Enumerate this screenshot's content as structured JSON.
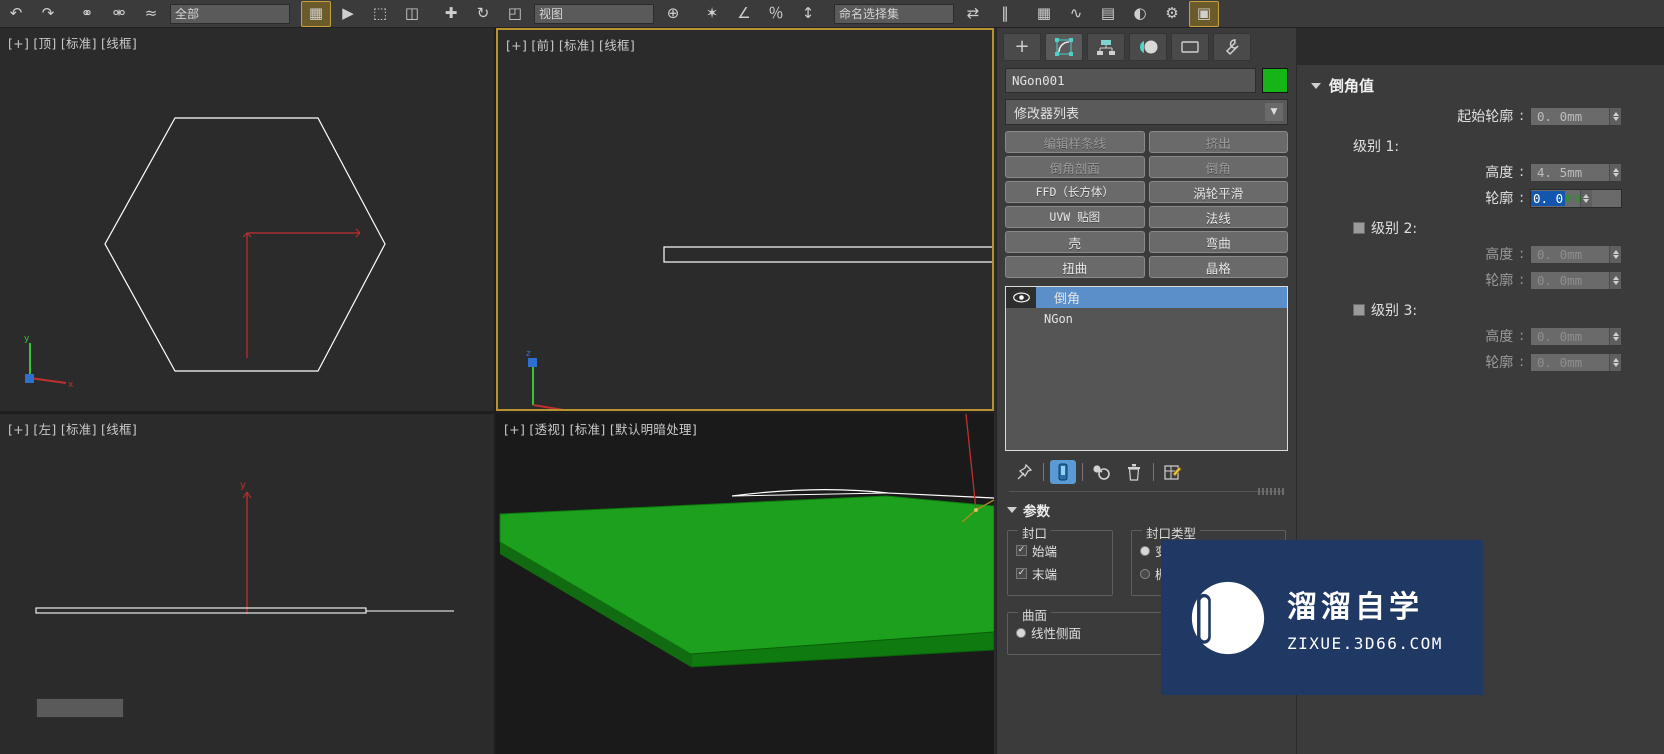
{
  "toolbar": {
    "items": [
      {
        "name": "undo-icon",
        "glyph": "↶"
      },
      {
        "name": "redo-icon",
        "glyph": "↷"
      },
      {
        "name": "select-link-icon",
        "glyph": "⚭"
      },
      {
        "name": "unlink-icon",
        "glyph": "⚮"
      },
      {
        "name": "bind-space-warp-icon",
        "glyph": "≈"
      },
      {
        "name": "selection-filter-dropdown",
        "glyph": "全部"
      },
      {
        "name": "select-object-icon",
        "glyph": "⬚"
      },
      {
        "name": "select-by-name-icon",
        "glyph": "↖"
      },
      {
        "name": "select-region-icon",
        "glyph": "⬚"
      },
      {
        "name": "window-crossing-icon",
        "glyph": "◫"
      },
      {
        "name": "select-and-move-icon",
        "glyph": "✚"
      },
      {
        "name": "select-and-rotate-icon",
        "glyph": "↻"
      },
      {
        "name": "select-and-scale-icon",
        "glyph": "◰"
      },
      {
        "name": "reference-coord-system",
        "glyph": "视图"
      },
      {
        "name": "use-pivot-icon",
        "glyph": "⊕"
      },
      {
        "name": "snap-toggle-icon",
        "glyph": "✦"
      },
      {
        "name": "angle-snap-icon",
        "glyph": "∠"
      },
      {
        "name": "percent-snap-icon",
        "glyph": "％"
      },
      {
        "name": "spinner-snap-icon",
        "glyph": "↕"
      },
      {
        "name": "named-selection-field",
        "glyph": "命名选择集"
      },
      {
        "name": "mirror-icon",
        "glyph": "⇄"
      },
      {
        "name": "align-icon",
        "glyph": "‖"
      },
      {
        "name": "layer-manager-icon",
        "glyph": "▦"
      },
      {
        "name": "curve-editor-icon",
        "glyph": "∿"
      },
      {
        "name": "schematic-view-icon",
        "glyph": "▤"
      },
      {
        "name": "material-editor-icon",
        "glyph": "◐"
      },
      {
        "name": "render-setup-icon",
        "glyph": "⚙"
      },
      {
        "name": "render-frame-icon",
        "glyph": "▣"
      },
      {
        "name": "render-production-icon",
        "glyph": "☕"
      }
    ]
  },
  "viewports": {
    "top": {
      "label": "[+] [顶] [标准] [线框]"
    },
    "front": {
      "label": "[+] [前] [标准] [线框]"
    },
    "left": {
      "label": "[+] [左] [标准] [线框]"
    },
    "persp": {
      "label": "[+] [透视] [标准] [默认明暗处理]"
    }
  },
  "command_panel": {
    "tabs": [
      {
        "name": "create-tab",
        "icon": "＋"
      },
      {
        "name": "modify-tab",
        "icon": "⬡"
      },
      {
        "name": "hierarchy-tab",
        "icon": "┳"
      },
      {
        "name": "motion-tab",
        "icon": "◑"
      },
      {
        "name": "display-tab",
        "icon": "▭"
      },
      {
        "name": "utilities-tab",
        "icon": "🔧"
      }
    ],
    "object_name": "NGon001",
    "object_color": "#17b417",
    "modifier_list_label": "修改器列表",
    "modifier_buttons": [
      {
        "label": "编辑样条线",
        "dim": true,
        "mono": false
      },
      {
        "label": "挤出",
        "dim": true,
        "mono": false
      },
      {
        "label": "倒角剖面",
        "dim": true,
        "mono": false
      },
      {
        "label": "倒角",
        "dim": true,
        "mono": false
      },
      {
        "label": "FFD（长方体）",
        "dim": false,
        "mono": true
      },
      {
        "label": "涡轮平滑",
        "dim": false,
        "mono": false
      },
      {
        "label": "UVW 贴图",
        "dim": false,
        "mono": true
      },
      {
        "label": "法线",
        "dim": false,
        "mono": false
      },
      {
        "label": "壳",
        "dim": false,
        "mono": false
      },
      {
        "label": "弯曲",
        "dim": false,
        "mono": false
      },
      {
        "label": "扭曲",
        "dim": false,
        "mono": false
      },
      {
        "label": "晶格",
        "dim": false,
        "mono": false
      }
    ],
    "stack": [
      {
        "label": "倒角",
        "selected": true,
        "has_eye": true,
        "mono": false
      },
      {
        "label": "NGon",
        "selected": false,
        "has_eye": false,
        "mono": true
      }
    ],
    "stack_tools": [
      {
        "name": "pin-stack-icon",
        "glyph": "📌",
        "active": false
      },
      {
        "name": "show-end-result-icon",
        "glyph": "▐",
        "active": true
      },
      {
        "name": "make-unique-icon",
        "glyph": "⚭",
        "active": false
      },
      {
        "name": "remove-modifier-icon",
        "glyph": "🗑",
        "active": false
      },
      {
        "name": "configure-sets-icon",
        "glyph": "▦",
        "active": false
      }
    ],
    "parameters": {
      "title": "参数",
      "capping": {
        "group_label": "封口",
        "start": {
          "label": "始端",
          "checked": true
        },
        "end": {
          "label": "末端",
          "checked": true
        }
      },
      "cap_type": {
        "group_label": "封口类型",
        "options": [
          {
            "label": "变形",
            "selected": true
          },
          {
            "label": "栅格",
            "selected": false
          }
        ]
      },
      "surface": {
        "group_label": "曲面",
        "options": [
          {
            "label": "线性侧面",
            "selected": true
          }
        ]
      }
    }
  },
  "bevel_values": {
    "title": "倒角值",
    "start_outline": {
      "label": "起始轮廓",
      "value": "0. 0mm",
      "enabled": true
    },
    "levels": [
      {
        "label": "级别 1:",
        "has_checkbox": false,
        "checked": true,
        "height": {
          "label": "高度",
          "value": "4. 5mm",
          "enabled": true,
          "editing": false
        },
        "outline": {
          "label": "轮廓",
          "value": "0. 0",
          "unit": "mm",
          "enabled": true,
          "editing": true
        }
      },
      {
        "label": "级别 2:",
        "has_checkbox": true,
        "checked": false,
        "height": {
          "label": "高度",
          "value": "0. 0mm",
          "enabled": false,
          "editing": false
        },
        "outline": {
          "label": "轮廓",
          "value": "0. 0mm",
          "enabled": false,
          "editing": false
        }
      },
      {
        "label": "级别 3:",
        "has_checkbox": true,
        "checked": false,
        "height": {
          "label": "高度",
          "value": "0. 0mm",
          "enabled": false,
          "editing": false
        },
        "outline": {
          "label": "轮廓",
          "value": "0. 0mm",
          "enabled": false,
          "editing": false
        }
      }
    ],
    "highlight_color": "#e01b1b"
  },
  "watermark": {
    "title_cn": "溜溜自学",
    "title_en": "ZIXUE.3D66.COM",
    "bg_color": "#1f3864"
  }
}
